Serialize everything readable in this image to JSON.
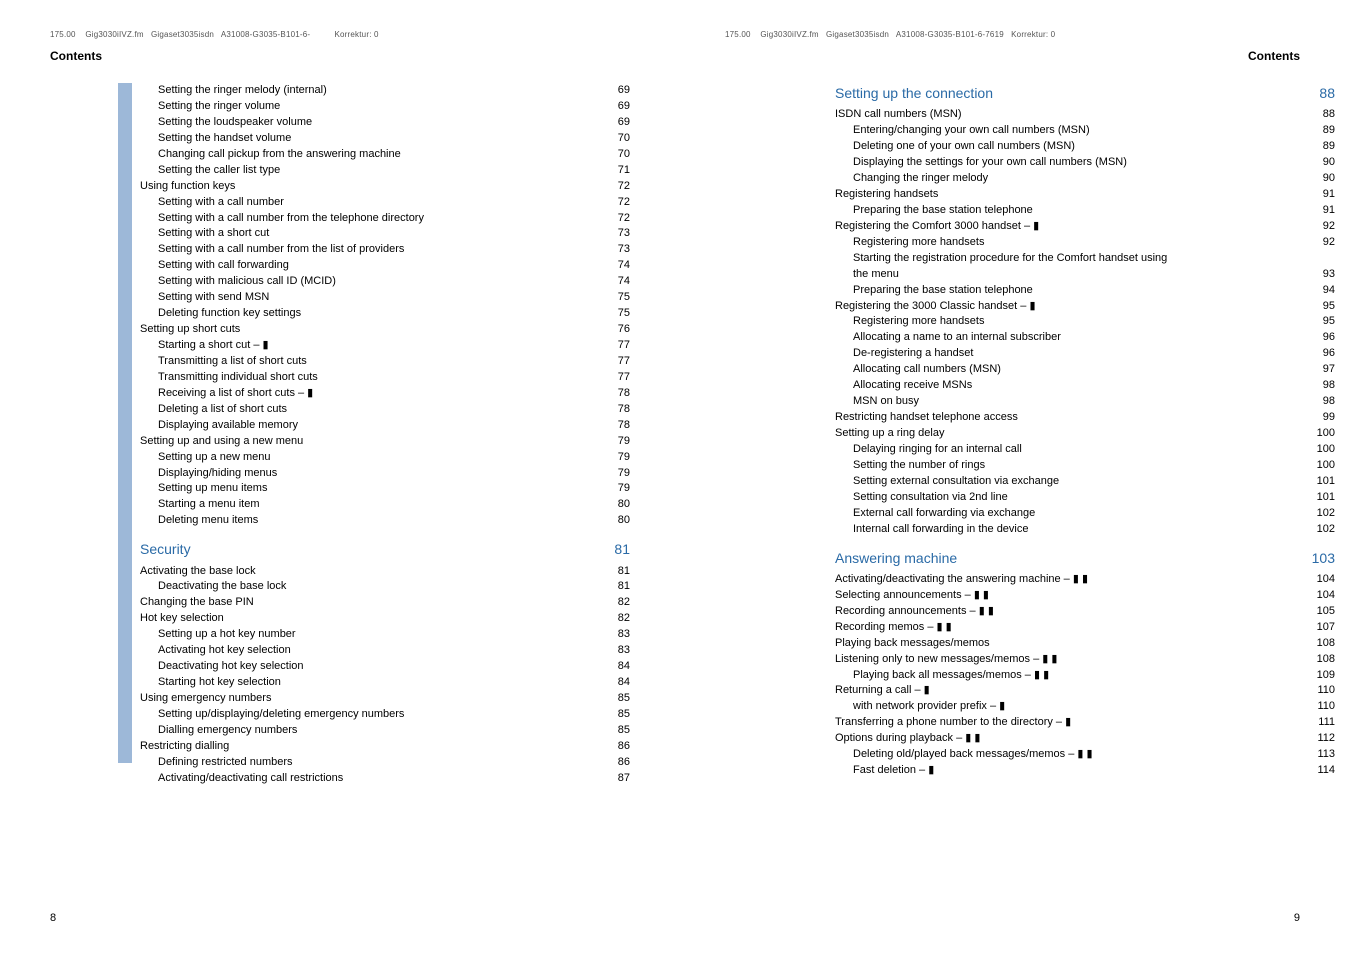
{
  "left": {
    "header": "175.00    Gig3030iIVZ.fm   Gigaset3035isdn   A31008-G3035-B101-6-          Korrektur: 0",
    "contents_label": "Contents",
    "page_number": "8",
    "lines": [
      {
        "indent": 2,
        "label": "Setting the ringer melody (internal)",
        "pg": "69"
      },
      {
        "indent": 2,
        "label": "Setting the ringer volume",
        "pg": "69"
      },
      {
        "indent": 2,
        "label": "Setting the loudspeaker volume",
        "pg": "69"
      },
      {
        "indent": 2,
        "label": "Setting the handset volume",
        "pg": "70"
      },
      {
        "indent": 2,
        "label": "Changing call pickup from the answering machine",
        "pg": "70"
      },
      {
        "indent": 2,
        "label": "Setting the caller list type",
        "pg": "71"
      },
      {
        "indent": 1,
        "label": "Using function keys",
        "pg": "72"
      },
      {
        "indent": 2,
        "label": "Setting with a call number",
        "pg": "72"
      },
      {
        "indent": 2,
        "label": "Setting with a call number from the telephone directory",
        "pg": "72"
      },
      {
        "indent": 2,
        "label": "Setting with a short cut",
        "pg": "73"
      },
      {
        "indent": 2,
        "label": "Setting with a call number from the list of providers",
        "pg": "73"
      },
      {
        "indent": 2,
        "label": "Setting with call forwarding",
        "pg": "74"
      },
      {
        "indent": 2,
        "label": "Setting with malicious call ID (MCID)",
        "pg": "74"
      },
      {
        "indent": 2,
        "label": "Setting with send MSN",
        "pg": "75"
      },
      {
        "indent": 2,
        "label": "Deleting function key settings",
        "pg": "75"
      },
      {
        "indent": 1,
        "label": "Setting up short cuts",
        "pg": "76"
      },
      {
        "indent": 2,
        "label": "Starting a short cut – ▮",
        "pg": "77"
      },
      {
        "indent": 2,
        "label": "Transmitting a list of short cuts",
        "pg": "77"
      },
      {
        "indent": 2,
        "label": "Transmitting individual short cuts",
        "pg": "77"
      },
      {
        "indent": 2,
        "label": "Receiving a list of short cuts – ▮",
        "pg": "78"
      },
      {
        "indent": 2,
        "label": "Deleting a list of short cuts",
        "pg": "78"
      },
      {
        "indent": 2,
        "label": "Displaying available memory",
        "pg": "78"
      },
      {
        "indent": 1,
        "label": "Setting up and using a new menu",
        "pg": "79"
      },
      {
        "indent": 2,
        "label": "Setting up a new menu",
        "pg": "79"
      },
      {
        "indent": 2,
        "label": "Displaying/hiding menus",
        "pg": "79"
      },
      {
        "indent": 2,
        "label": "Setting up menu items",
        "pg": "79"
      },
      {
        "indent": 2,
        "label": "Starting a menu item",
        "pg": "80"
      },
      {
        "indent": 2,
        "label": "Deleting menu items",
        "pg": "80"
      },
      {
        "indent": 0,
        "section": true,
        "label": "Security",
        "pg": "81"
      },
      {
        "indent": 1,
        "label": "Activating the base lock",
        "pg": "81"
      },
      {
        "indent": 2,
        "label": "Deactivating the base lock",
        "pg": "81"
      },
      {
        "indent": 1,
        "label": "Changing the base PIN",
        "pg": "82"
      },
      {
        "indent": 1,
        "label": "Hot key selection",
        "pg": "82"
      },
      {
        "indent": 2,
        "label": "Setting up a hot key number",
        "pg": "83"
      },
      {
        "indent": 2,
        "label": "Activating hot key selection",
        "pg": "83"
      },
      {
        "indent": 2,
        "label": "Deactivating hot key selection",
        "pg": "84"
      },
      {
        "indent": 2,
        "label": "Starting hot key selection",
        "pg": "84"
      },
      {
        "indent": 1,
        "label": "Using emergency numbers",
        "pg": "85"
      },
      {
        "indent": 2,
        "label": "Setting up/displaying/deleting emergency numbers",
        "pg": "85"
      },
      {
        "indent": 2,
        "label": "Dialling emergency numbers",
        "pg": "85"
      },
      {
        "indent": 1,
        "label": "Restricting dialling",
        "pg": "86"
      },
      {
        "indent": 2,
        "label": "Defining restricted numbers",
        "pg": "86"
      },
      {
        "indent": 2,
        "label": "Activating/deactivating call restrictions",
        "pg": "87"
      }
    ]
  },
  "right": {
    "header": "175.00    Gig3030iIVZ.fm   Gigaset3035isdn   A31008-G3035-B101-6-7619   Korrektur: 0",
    "contents_label": "Contents",
    "page_number": "9",
    "lines": [
      {
        "indent": 0,
        "section": true,
        "label": "Setting up the connection",
        "pg": "88"
      },
      {
        "indent": 1,
        "label": "ISDN call numbers (MSN)",
        "pg": "88"
      },
      {
        "indent": 2,
        "label": "Entering/changing your own call numbers (MSN)",
        "pg": "89"
      },
      {
        "indent": 2,
        "label": "Deleting one of your own call numbers (MSN)",
        "pg": "89"
      },
      {
        "indent": 2,
        "label": "Displaying the settings for your own call numbers (MSN)",
        "pg": "90"
      },
      {
        "indent": 2,
        "label": "Changing the ringer melody",
        "pg": "90"
      },
      {
        "indent": 1,
        "label": "Registering handsets",
        "pg": "91"
      },
      {
        "indent": 2,
        "label": "Preparing the base station telephone",
        "pg": "91"
      },
      {
        "indent": 1,
        "label": "Registering the Comfort 3000 handset – ▮",
        "pg": "92"
      },
      {
        "indent": 2,
        "label": "Registering more handsets",
        "pg": "92"
      },
      {
        "indent": 2,
        "label": "Starting the registration procedure for the Comfort handset using",
        "pg": ""
      },
      {
        "indent": 2,
        "label": "the menu",
        "pg": "93"
      },
      {
        "indent": 2,
        "label": "Preparing the base station telephone",
        "pg": "94"
      },
      {
        "indent": 1,
        "label": "Registering the 3000 Classic handset – ▮",
        "pg": "95"
      },
      {
        "indent": 2,
        "label": "Registering more handsets",
        "pg": "95"
      },
      {
        "indent": 2,
        "label": "Allocating a name to an internal subscriber",
        "pg": "96"
      },
      {
        "indent": 2,
        "label": "De-registering a handset",
        "pg": "96"
      },
      {
        "indent": 2,
        "label": "Allocating call numbers (MSN)",
        "pg": "97"
      },
      {
        "indent": 2,
        "label": "Allocating receive MSNs",
        "pg": "98"
      },
      {
        "indent": 2,
        "label": "MSN on busy",
        "pg": "98"
      },
      {
        "indent": 1,
        "label": "Restricting handset telephone access",
        "pg": "99"
      },
      {
        "indent": 1,
        "label": "Setting up a ring delay",
        "pg": "100"
      },
      {
        "indent": 2,
        "label": "Delaying ringing for an internal call",
        "pg": "100"
      },
      {
        "indent": 2,
        "label": "Setting the number of rings",
        "pg": "100"
      },
      {
        "indent": 2,
        "label": "Setting external consultation via exchange",
        "pg": "101"
      },
      {
        "indent": 2,
        "label": "Setting consultation via 2nd line",
        "pg": "101"
      },
      {
        "indent": 2,
        "label": "External call forwarding via exchange",
        "pg": "102"
      },
      {
        "indent": 2,
        "label": "Internal call forwarding in the device",
        "pg": "102"
      },
      {
        "indent": 0,
        "section": true,
        "label": "Answering machine",
        "pg": "103"
      },
      {
        "indent": 1,
        "label": "Activating/deactivating the answering machine – ▮ ▮",
        "pg": "104"
      },
      {
        "indent": 1,
        "label": "Selecting announcements – ▮ ▮",
        "pg": "104"
      },
      {
        "indent": 1,
        "label": "Recording announcements – ▮ ▮",
        "pg": "105"
      },
      {
        "indent": 1,
        "label": "Recording memos – ▮ ▮",
        "pg": "107"
      },
      {
        "indent": 1,
        "label": "Playing back messages/memos",
        "pg": "108"
      },
      {
        "indent": 1,
        "label": "Listening only to new messages/memos – ▮ ▮",
        "pg": "108"
      },
      {
        "indent": 2,
        "label": "Playing back all messages/memos – ▮ ▮",
        "pg": "109"
      },
      {
        "indent": 1,
        "label": "Returning a call – ▮",
        "pg": "110"
      },
      {
        "indent": 2,
        "label": "with network provider prefix – ▮",
        "pg": "110"
      },
      {
        "indent": 1,
        "label": "Transferring a phone number to the directory – ▮",
        "pg": "111"
      },
      {
        "indent": 1,
        "label": "Options during playback – ▮ ▮",
        "pg": "112"
      },
      {
        "indent": 2,
        "label": "Deleting old/played back messages/memos – ▮ ▮",
        "pg": "113"
      },
      {
        "indent": 2,
        "label": "Fast deletion – ▮",
        "pg": "114"
      }
    ]
  }
}
